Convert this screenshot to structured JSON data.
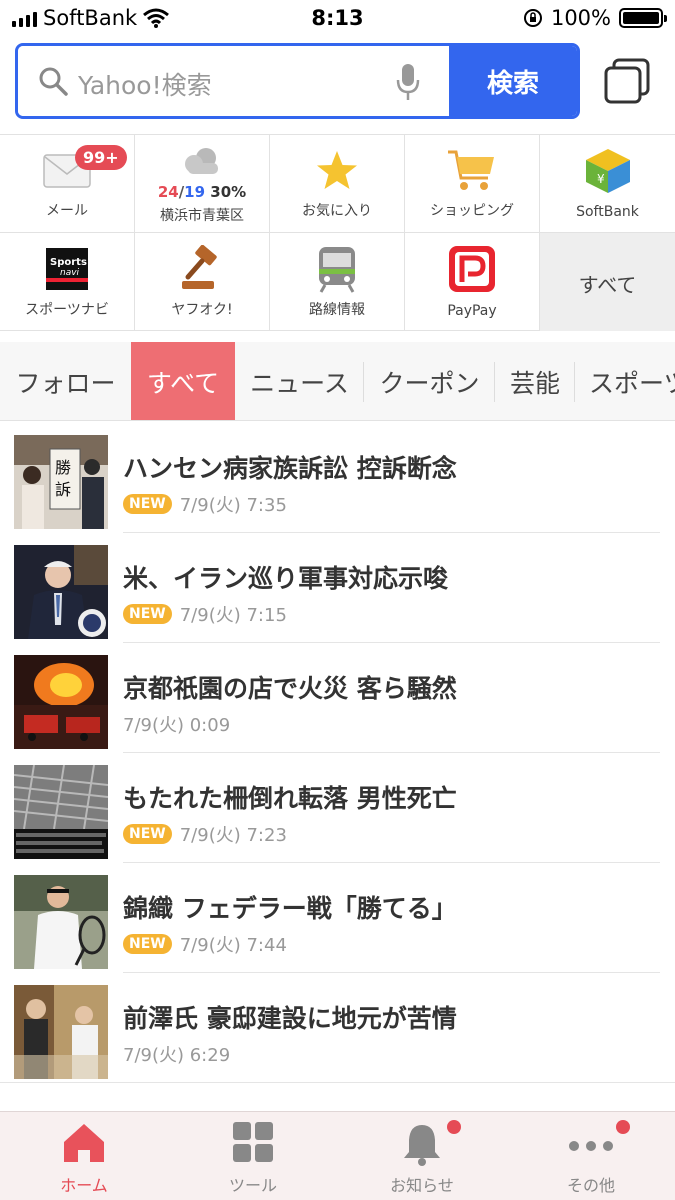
{
  "status_bar": {
    "carrier": "SoftBank",
    "time": "8:13",
    "battery": "100%"
  },
  "search": {
    "placeholder": "Yahoo!検索",
    "button_label": "検索"
  },
  "tools": {
    "mail": {
      "label": "メール",
      "badge": "99+"
    },
    "weather": {
      "high": "24",
      "separator": "/",
      "low": "19",
      "precip": "30%",
      "location": "横浜市青葉区"
    },
    "favorites": {
      "label": "お気に入り"
    },
    "shopping": {
      "label": "ショッピング"
    },
    "softbank": {
      "label": "SoftBank"
    },
    "sportsnavi": {
      "label": "スポーツナビ"
    },
    "auction": {
      "label": "ヤフオク!"
    },
    "transit": {
      "label": "路線情報"
    },
    "paypay": {
      "label": "PayPay"
    },
    "all": {
      "label": "すべて"
    }
  },
  "category_tabs": [
    {
      "label": "フォロー",
      "active": false
    },
    {
      "label": "すべて",
      "active": true
    },
    {
      "label": "ニュース",
      "active": false
    },
    {
      "label": "クーポン",
      "active": false
    },
    {
      "label": "芸能",
      "active": false
    },
    {
      "label": "スポーツ",
      "active": false
    }
  ],
  "news": [
    {
      "title": "ハンセン病家族訴訟 控訴断念",
      "is_new": true,
      "new_label": "NEW",
      "date": "7/9(火) 7:35"
    },
    {
      "title": "米、イラン巡り軍事対応示唆",
      "is_new": true,
      "new_label": "NEW",
      "date": "7/9(火) 7:15"
    },
    {
      "title": "京都祇園の店で火災 客ら騒然",
      "is_new": false,
      "new_label": "",
      "date": "7/9(火) 0:09"
    },
    {
      "title": "もたれた柵倒れ転落 男性死亡",
      "is_new": true,
      "new_label": "NEW",
      "date": "7/9(火) 7:23"
    },
    {
      "title": "錦織 フェデラー戦「勝てる」",
      "is_new": true,
      "new_label": "NEW",
      "date": "7/9(火) 7:44"
    },
    {
      "title": "前澤氏 豪邸建設に地元が苦情",
      "is_new": false,
      "new_label": "",
      "date": "7/9(火) 6:29"
    }
  ],
  "bottom_nav": {
    "home": "ホーム",
    "tools": "ツール",
    "notifications": "お知らせ",
    "other": "その他"
  },
  "colors": {
    "accent_blue": "#3366ee",
    "tab_active": "#ee6e73",
    "badge_red": "#e54b55",
    "new_badge": "#f5b332"
  }
}
